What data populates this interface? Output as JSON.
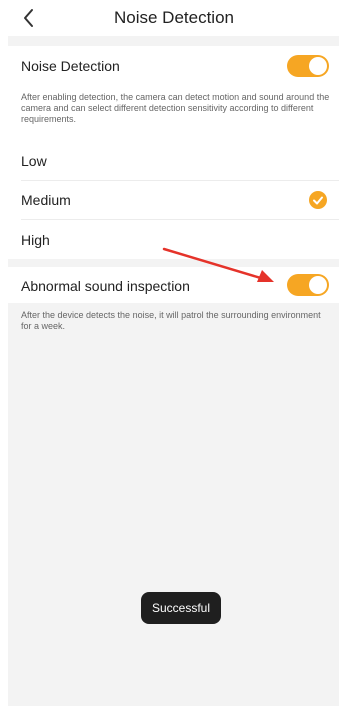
{
  "header": {
    "title": "Noise Detection"
  },
  "noise_section": {
    "label": "Noise Detection",
    "enabled": true,
    "description": "After enabling detection, the camera can detect motion and sound around the camera and can select different detection sensitivity according to different requirements."
  },
  "sensitivity": {
    "options": [
      "Low",
      "Medium",
      "High"
    ],
    "selected": "Medium"
  },
  "abnormal_section": {
    "label": "Abnormal sound inspection",
    "enabled": true,
    "description": "After the device detects the noise, it will patrol the surrounding environment for a week."
  },
  "toast": {
    "text": "Successful"
  },
  "colors": {
    "accent": "#f6a623",
    "annotation_arrow": "#e5332a"
  }
}
